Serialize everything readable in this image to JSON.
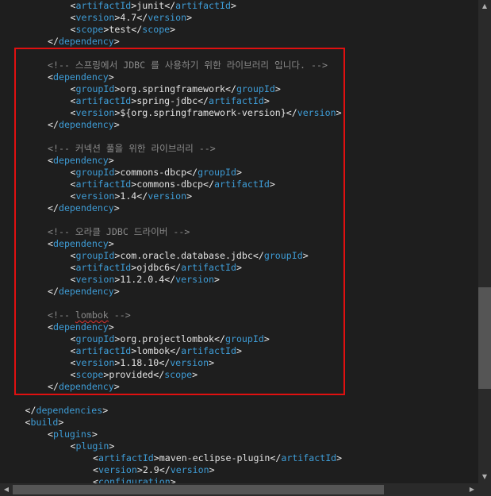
{
  "colors": {
    "background": "#1e1e1e",
    "tag": "#3e9cd6",
    "bracket": "#e8e8e8",
    "text": "#e2e2e2",
    "comment": "#8a8a8a",
    "highlight_border": "#e01010",
    "scrollbar_track": "#2a2a2a",
    "scrollbar_thumb": "#555555"
  },
  "editor": {
    "lines": [
      {
        "indent": 3,
        "kind": "element",
        "tag": "artifactId",
        "value": "junit"
      },
      {
        "indent": 3,
        "kind": "element",
        "tag": "version",
        "value": "4.7"
      },
      {
        "indent": 3,
        "kind": "element",
        "tag": "scope",
        "value": "test"
      },
      {
        "indent": 2,
        "kind": "close",
        "tag": "dependency"
      },
      {
        "indent": 0,
        "kind": "blank"
      },
      {
        "indent": 2,
        "kind": "comment",
        "text": "<!-- 스프링에서 JDBC 를 사용하기 위한 라이브러리 입니다. -->"
      },
      {
        "indent": 2,
        "kind": "open",
        "tag": "dependency"
      },
      {
        "indent": 3,
        "kind": "element",
        "tag": "groupId",
        "value": "org.springframework"
      },
      {
        "indent": 3,
        "kind": "element",
        "tag": "artifactId",
        "value": "spring-jdbc"
      },
      {
        "indent": 3,
        "kind": "element",
        "tag": "version",
        "value": "${org.springframework-version}"
      },
      {
        "indent": 2,
        "kind": "close",
        "tag": "dependency"
      },
      {
        "indent": 0,
        "kind": "blank"
      },
      {
        "indent": 2,
        "kind": "comment",
        "text": "<!-- 커넥션 풀을 위한 라이브러리 -->"
      },
      {
        "indent": 2,
        "kind": "open",
        "tag": "dependency"
      },
      {
        "indent": 3,
        "kind": "element",
        "tag": "groupId",
        "value": "commons-dbcp"
      },
      {
        "indent": 3,
        "kind": "element",
        "tag": "artifactId",
        "value": "commons-dbcp"
      },
      {
        "indent": 3,
        "kind": "element",
        "tag": "version",
        "value": "1.4"
      },
      {
        "indent": 2,
        "kind": "close",
        "tag": "dependency"
      },
      {
        "indent": 0,
        "kind": "blank"
      },
      {
        "indent": 2,
        "kind": "comment",
        "text": "<!-- 오라클 JDBC 드라이버 -->"
      },
      {
        "indent": 2,
        "kind": "open",
        "tag": "dependency"
      },
      {
        "indent": 3,
        "kind": "element",
        "tag": "groupId",
        "value": "com.oracle.database.jdbc"
      },
      {
        "indent": 3,
        "kind": "element",
        "tag": "artifactId",
        "value": "ojdbc6"
      },
      {
        "indent": 3,
        "kind": "element",
        "tag": "version",
        "value": "11.2.0.4"
      },
      {
        "indent": 2,
        "kind": "close",
        "tag": "dependency"
      },
      {
        "indent": 0,
        "kind": "blank"
      },
      {
        "indent": 2,
        "kind": "comment",
        "text": "<!-- lombok -->",
        "squiggle": "lombok"
      },
      {
        "indent": 2,
        "kind": "open",
        "tag": "dependency"
      },
      {
        "indent": 3,
        "kind": "element",
        "tag": "groupId",
        "value": "org.projectlombok"
      },
      {
        "indent": 3,
        "kind": "element",
        "tag": "artifactId",
        "value": "lombok"
      },
      {
        "indent": 3,
        "kind": "element",
        "tag": "version",
        "value": "1.18.10"
      },
      {
        "indent": 3,
        "kind": "element",
        "tag": "scope",
        "value": "provided"
      },
      {
        "indent": 2,
        "kind": "close",
        "tag": "dependency"
      },
      {
        "indent": 0,
        "kind": "blank"
      },
      {
        "indent": 1,
        "kind": "close",
        "tag": "dependencies"
      },
      {
        "indent": 1,
        "kind": "open",
        "tag": "build"
      },
      {
        "indent": 2,
        "kind": "open",
        "tag": "plugins"
      },
      {
        "indent": 3,
        "kind": "open",
        "tag": "plugin"
      },
      {
        "indent": 4,
        "kind": "element",
        "tag": "artifactId",
        "value": "maven-eclipse-plugin"
      },
      {
        "indent": 4,
        "kind": "element",
        "tag": "version",
        "value": "2.9"
      },
      {
        "indent": 4,
        "kind": "open",
        "tag": "configuration"
      }
    ]
  },
  "icons": {
    "scroll_up": "▲",
    "scroll_down": "▼",
    "scroll_left": "◀",
    "scroll_right": "▶"
  }
}
